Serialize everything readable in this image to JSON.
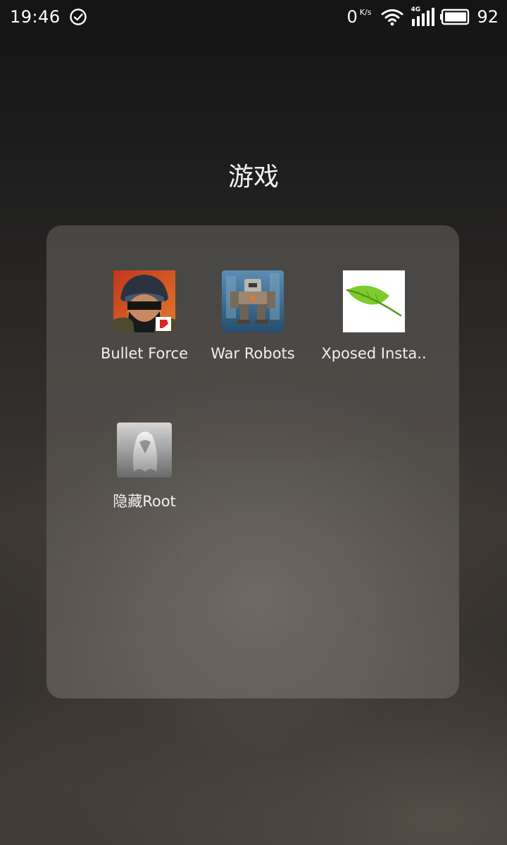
{
  "status_bar": {
    "time": "19:46",
    "net_speed": "0",
    "net_speed_unit": "K/s",
    "network_type": "4G",
    "battery_level": "92",
    "icons": [
      "check-circle-icon",
      "wifi-icon",
      "signal-icon",
      "battery-icon"
    ]
  },
  "folder": {
    "title": "游戏",
    "apps": [
      {
        "label": "Bullet Force",
        "icon": "bullet-force-icon"
      },
      {
        "label": "War Robots",
        "icon": "war-robots-icon"
      },
      {
        "label": "Xposed Insta..",
        "icon": "xposed-leaf-icon"
      },
      {
        "label": "隐藏Root",
        "icon": "hide-root-ghost-icon"
      }
    ]
  },
  "colors": {
    "text": "#ffffff",
    "xposed_leaf": "#7ecb2e",
    "war_robots_bg": "#3a6b8f"
  }
}
